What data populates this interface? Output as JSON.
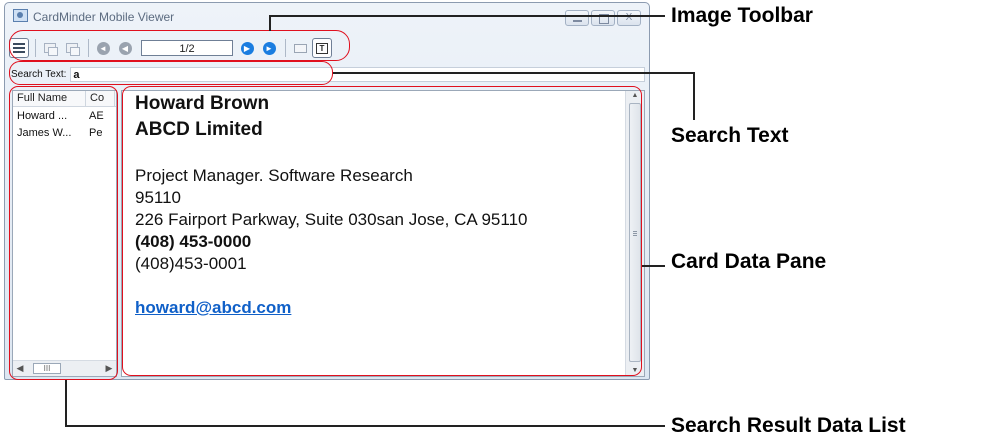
{
  "window": {
    "title": "CardMinder Mobile Viewer",
    "controls": {
      "minimize": "",
      "maximize": "",
      "close": "X"
    }
  },
  "toolbar": {
    "page_indicator": "1/2",
    "buttons": [
      "list-view-icon",
      "copy-icon",
      "paste-icon",
      "first-page-icon",
      "previous-page-icon",
      "next-page-icon",
      "last-page-icon",
      "email-icon",
      "text-icon"
    ],
    "text_button": "T"
  },
  "search": {
    "label": "Search Text:",
    "value": "a"
  },
  "result_list": {
    "columns": [
      "Full Name",
      "Co"
    ],
    "rows": [
      {
        "name": "Howard ...",
        "company": "AE"
      },
      {
        "name": "James W...",
        "company": "Pe"
      }
    ],
    "scroll_thumb": "III"
  },
  "card": {
    "name": "Howard Brown",
    "company": "ABCD Limited",
    "title": "Project Manager. Software Research",
    "zip": "95110",
    "address": "226 Fairport Parkway, Suite 030san Jose, CA 95110",
    "phone_main": "(408) 453-0000",
    "phone_alt": "(408)453-0001",
    "email": "howard@abcd.com"
  },
  "callouts": {
    "toolbar": "Image Toolbar",
    "search": "Search Text",
    "card": "Card Data Pane",
    "list": "Search Result Data List"
  },
  "colors": {
    "callout_outline": "#e0101e",
    "email_link": "#1060c8",
    "nav_active": "#1a7de0"
  }
}
